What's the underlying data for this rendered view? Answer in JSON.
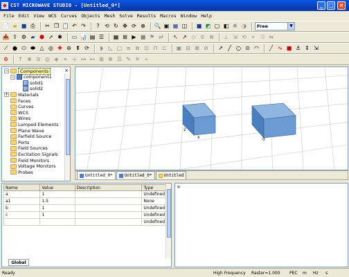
{
  "title": "CST MICROWAVE STUDIO - [Untitled_0*]",
  "menu": [
    "File",
    "Edit",
    "View",
    "WCS",
    "Curves",
    "Objects",
    "Mesh",
    "Solve",
    "Results",
    "Macros",
    "Window",
    "Help"
  ],
  "toolbar": {
    "view_mode_value": "Free"
  },
  "tree": {
    "items": [
      {
        "label": "Components",
        "kind": "folder",
        "level": 0,
        "expander": "-",
        "selected": true
      },
      {
        "label": "component1",
        "kind": "component",
        "level": 1,
        "expander": "-"
      },
      {
        "label": "solid1",
        "kind": "solid",
        "level": 2
      },
      {
        "label": "solid2",
        "kind": "solid",
        "level": 2
      },
      {
        "label": "Materials",
        "kind": "folder",
        "level": 0,
        "expander": "+"
      },
      {
        "label": "Faces",
        "kind": "folder",
        "level": 0
      },
      {
        "label": "Curves",
        "kind": "folder",
        "level": 0
      },
      {
        "label": "WCS",
        "kind": "folder",
        "level": 0
      },
      {
        "label": "Wires",
        "kind": "folder",
        "level": 0
      },
      {
        "label": "Lumped Elements",
        "kind": "folder",
        "level": 0
      },
      {
        "label": "Plane Wave",
        "kind": "folder",
        "level": 0
      },
      {
        "label": "Farfield Source",
        "kind": "folder",
        "level": 0
      },
      {
        "label": "Ports",
        "kind": "folder",
        "level": 0
      },
      {
        "label": "Field Sources",
        "kind": "folder",
        "level": 0
      },
      {
        "label": "Excitation Signals",
        "kind": "folder",
        "level": 0
      },
      {
        "label": "Field Monitors",
        "kind": "folder",
        "level": 0
      },
      {
        "label": "Voltage Monitors",
        "kind": "folder",
        "level": 0
      },
      {
        "label": "Probes",
        "kind": "folder",
        "level": 0
      }
    ]
  },
  "viewport": {
    "label_2": "2",
    "label_x": "x",
    "label_0": "0"
  },
  "view_tabs": [
    "Untitled_0*",
    "Untitled_0*",
    "Untitled"
  ],
  "parameters": {
    "columns": [
      "Name",
      "Value",
      "Description",
      "Type"
    ],
    "rows": [
      {
        "name": "a",
        "value": "1",
        "description": "",
        "type": "Undefined"
      },
      {
        "name": "a1",
        "value": "1.5",
        "description": "",
        "type": "None"
      },
      {
        "name": "b",
        "value": "1",
        "description": "",
        "type": "Undefined"
      },
      {
        "name": "c",
        "value": "1",
        "description": "",
        "type": "Undefined"
      },
      {
        "name": "",
        "value": "",
        "description": "",
        "type": "Undefined"
      }
    ],
    "tab_label": "Global"
  },
  "status": {
    "left": "Ready",
    "mode": "High Frequency",
    "raster": "Raster=1.000",
    "pec": "PEC",
    "unit_length": "m",
    "unit_freq": "Hz",
    "unit_time": "s"
  },
  "icons": [
    "new-file-icon",
    "open-folder-icon",
    "save-icon",
    "print-icon",
    "cut-icon",
    "copy-icon",
    "paste-icon",
    "undo-icon",
    "redo-icon",
    "zoom-icon",
    "rotate-icon",
    "pan-icon",
    "fit-view-icon",
    "cube-icon",
    "cylinder-icon",
    "sphere-icon",
    "cone-icon",
    "torus-icon",
    "boolean-add-icon",
    "boolean-subtract-icon",
    "pick-point-icon",
    "ruler-icon"
  ]
}
